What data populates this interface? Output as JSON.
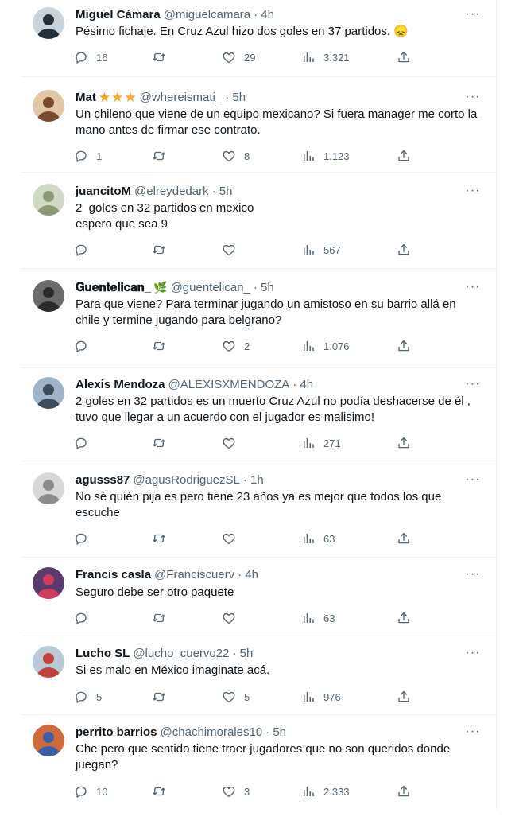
{
  "colors": {
    "text": "#0f1419",
    "secondary": "#536471",
    "border": "#eff3f4",
    "star": "#f5a623"
  },
  "icons": {
    "more": "more-horizontal-icon",
    "reply": "reply-bubble-icon",
    "retweet": "retweet-arrows-icon",
    "like": "heart-icon",
    "views": "bar-chart-icon",
    "share": "share-upload-icon"
  },
  "more_glyph": "···",
  "tweets": [
    {
      "name": "Miguel Cámara",
      "handle": "@miguelcamara",
      "time": "· 4h",
      "text": "Pésimo fichaje. En Cruz Azul hizo dos goles en 37 partidos. 😞",
      "replies": "16",
      "retweets": "",
      "likes": "29",
      "views": "3.321"
    },
    {
      "name": "Mat",
      "badge": [
        "★",
        "★",
        "★"
      ],
      "handle": "@whereismati_",
      "time": "· 5h",
      "text": "Un chileno que viene de un equipo mexicano? Si fuera manager me corto la\nmano antes de firmar ese contrato.",
      "replies": "1",
      "retweets": "",
      "likes": "8",
      "views": "1.123"
    },
    {
      "name": "juancitoM",
      "handle": "@elreydedark",
      "time": "· 5h",
      "text": "2  goles en 32 partidos en mexico\nespero que sea 9",
      "replies": "",
      "retweets": "",
      "likes": "",
      "views": "567"
    },
    {
      "name": "𝐆𝐮𝐞𝐧𝐭𝐞𝐥𝐢𝐜𝐚𝐧_",
      "leaf": "🌿",
      "handle": "@guentelican_",
      "time": "· 5h",
      "text": "Para que viene? Para terminar jugando un amistoso en su barrio allá en\nchile y termine jugando para belgrano?",
      "replies": "",
      "retweets": "",
      "likes": "2",
      "views": "1.076"
    },
    {
      "name": "Alexis Mendoza",
      "handle": "@ALEXISXMENDOZA",
      "time": "· 4h",
      "text": "2 goles en 32 partidos es un muerto Cruz Azul no podía deshacerse de él ,\ntuvo que llegar a un acuerdo con el jugador es malisimo!",
      "replies": "",
      "retweets": "",
      "likes": "",
      "views": "271"
    },
    {
      "name": "agusss87",
      "handle": "@agusRodriguezSL",
      "time": "· 1h",
      "text": "No sé quién pija es pero tiene 23 años ya es mejor que todos los que\nescuche",
      "replies": "",
      "retweets": "",
      "likes": "",
      "views": "63"
    },
    {
      "name": "Francis casla",
      "handle": "@Franciscuerv",
      "time": "· 4h",
      "text": "Seguro debe ser otro paquete",
      "replies": "",
      "retweets": "",
      "likes": "",
      "views": "63"
    },
    {
      "name": "Lucho SL",
      "handle": "@lucho_cuervo22",
      "time": "· 5h",
      "text": "Si es malo en México imaginate acá.",
      "replies": "5",
      "retweets": "",
      "likes": "5",
      "views": "976"
    },
    {
      "name": "perrito barrios",
      "handle": "@chachimorales10",
      "time": "· 5h",
      "text": "Che pero que sentido tiene traer jugadores que no son queridos donde\njuegan?",
      "replies": "10",
      "retweets": "",
      "likes": "3",
      "views": "2.333"
    }
  ]
}
